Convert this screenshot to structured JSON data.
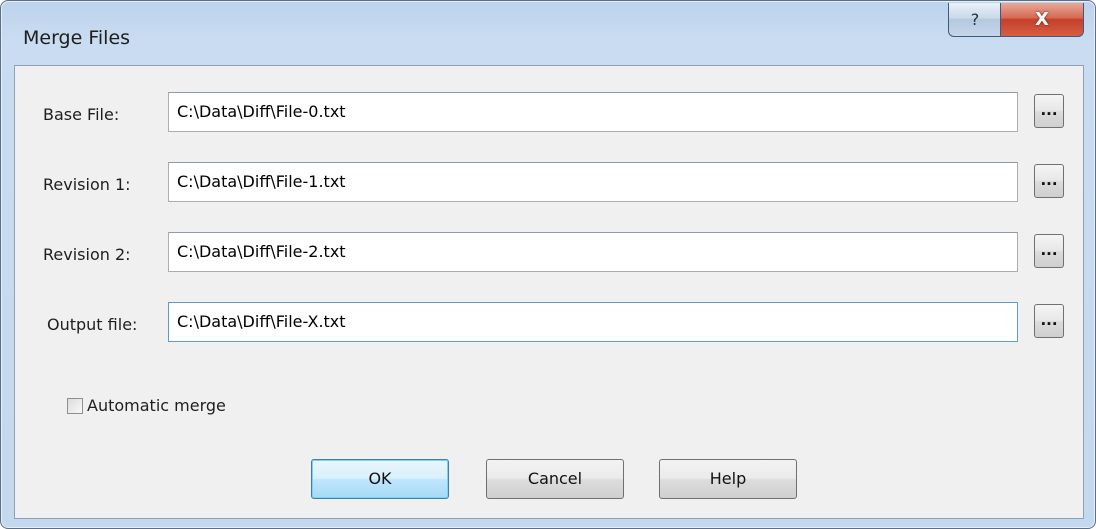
{
  "window": {
    "title": "Merge Files",
    "help_glyph": "?",
    "close_glyph": "X"
  },
  "fields": [
    {
      "label": "Base File:",
      "value": "C:\\Data\\Diff\\File-0.txt",
      "browse": "..."
    },
    {
      "label": "Revision 1:",
      "value": "C:\\Data\\Diff\\File-1.txt",
      "browse": "..."
    },
    {
      "label": "Revision 2:",
      "value": "C:\\Data\\Diff\\File-2.txt",
      "browse": "..."
    },
    {
      "label": "Output file:",
      "value": "C:\\Data\\Diff\\File-X.txt",
      "browse": "..."
    }
  ],
  "options": {
    "automatic_merge_label": "Automatic merge",
    "automatic_merge_checked": false
  },
  "buttons": {
    "ok": "OK",
    "cancel": "Cancel",
    "help": "Help"
  },
  "icons": {
    "help": "question-mark-icon",
    "close": "close-icon"
  }
}
